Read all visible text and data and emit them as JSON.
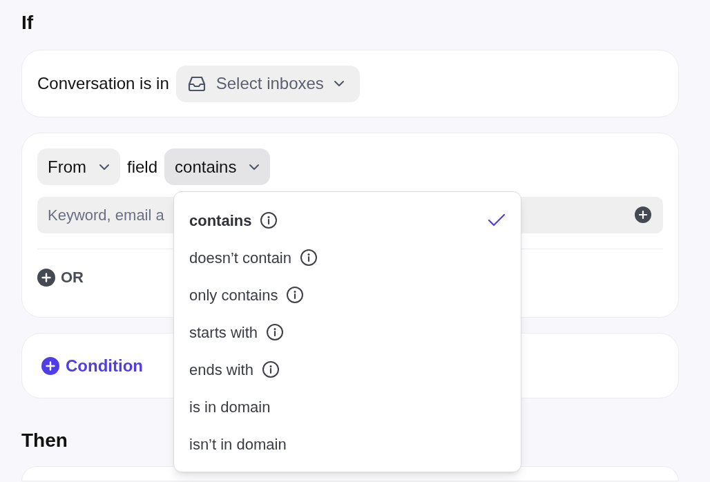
{
  "if_heading": "If",
  "inbox_condition": {
    "label": "Conversation is in",
    "select": {
      "placeholder": "Select inboxes"
    }
  },
  "field_condition": {
    "field_select": "From",
    "field_word": "field",
    "operator_select": {
      "value": "contains",
      "expanded": true
    },
    "keyword_input": {
      "placeholder": "Keyword, email a"
    },
    "or_button": "OR"
  },
  "operator_menu": [
    {
      "label": "contains",
      "info": true,
      "selected": true
    },
    {
      "label": "doesn’t contain",
      "info": true,
      "selected": false
    },
    {
      "label": "only contains",
      "info": true,
      "selected": false
    },
    {
      "label": "starts with",
      "info": true,
      "selected": false
    },
    {
      "label": "ends with",
      "info": true,
      "selected": false
    },
    {
      "label": "is in domain",
      "info": false,
      "selected": false
    },
    {
      "label": "isn’t in domain",
      "info": false,
      "selected": false
    }
  ],
  "add_condition_button": "Condition",
  "then_heading": "Then"
}
